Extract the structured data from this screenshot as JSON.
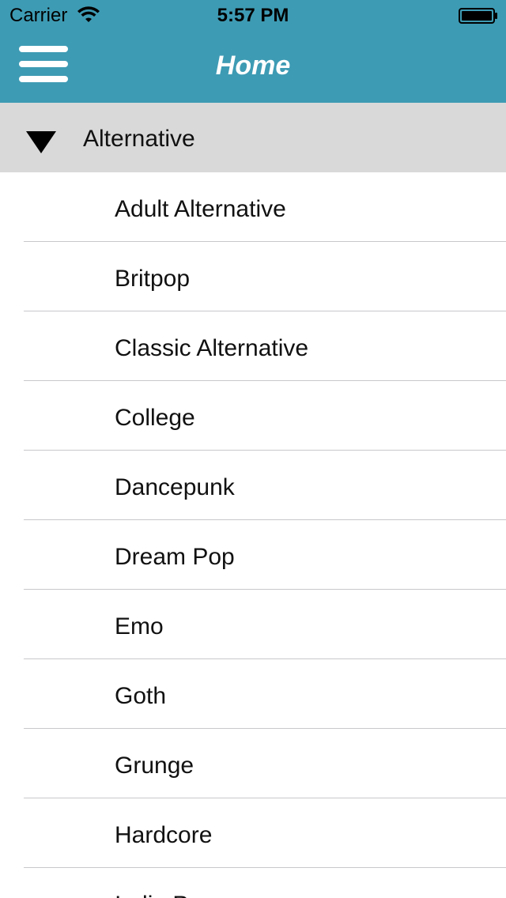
{
  "status_bar": {
    "carrier": "Carrier",
    "time": "5:57 PM",
    "wifi_icon": "wifi-icon",
    "battery_icon": "battery-icon"
  },
  "nav_bar": {
    "title": "Home",
    "menu_icon": "hamburger-menu-icon",
    "background_color": "#3e9bb4"
  },
  "section": {
    "label": "Alternative",
    "expanded": true,
    "icon": "triangle-down-icon",
    "background_color": "#d9d9d9"
  },
  "items": [
    {
      "label": "Adult Alternative"
    },
    {
      "label": "Britpop"
    },
    {
      "label": "Classic Alternative"
    },
    {
      "label": "College"
    },
    {
      "label": "Dancepunk"
    },
    {
      "label": "Dream Pop"
    },
    {
      "label": "Emo"
    },
    {
      "label": "Goth"
    },
    {
      "label": "Grunge"
    },
    {
      "label": "Hardcore"
    },
    {
      "label": "Indie Pop"
    }
  ]
}
